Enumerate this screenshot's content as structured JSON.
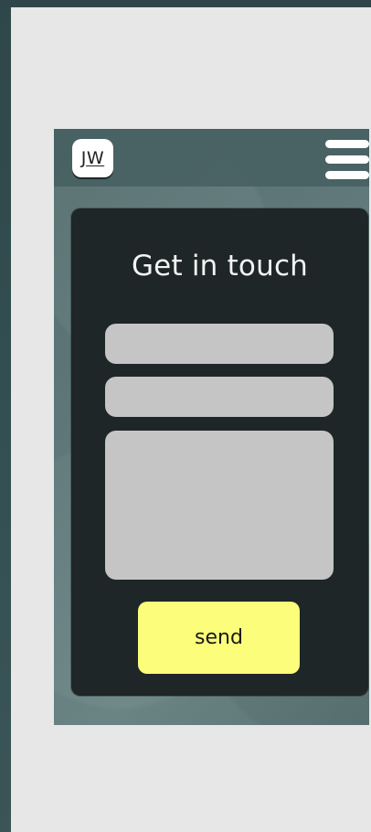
{
  "header": {
    "logo_text": "JW",
    "menu_icon": "hamburger-menu-icon"
  },
  "contact_form": {
    "title": "Get in touch",
    "fields": {
      "name_value": "",
      "name_placeholder": "",
      "email_value": "",
      "email_placeholder": "",
      "message_value": "",
      "message_placeholder": ""
    },
    "send_label": "send"
  },
  "colors": {
    "outer_background": "#2f4a4c",
    "canvas_background": "#e7e7e7",
    "phone_background": "#5f7779",
    "card_background": "#1f2627",
    "input_background": "#c5c5c5",
    "button_background": "#fcfd7a"
  }
}
